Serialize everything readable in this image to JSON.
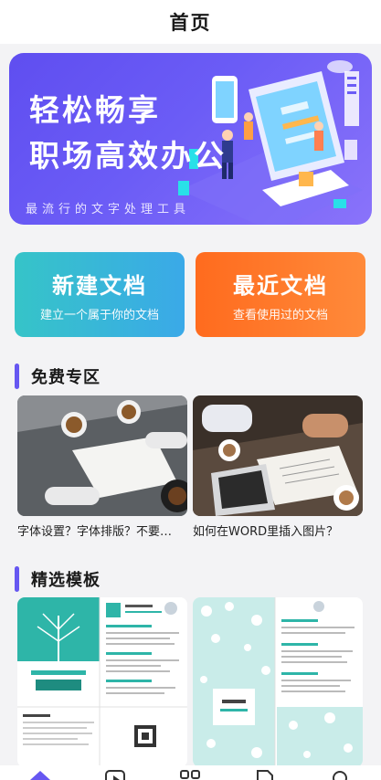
{
  "header": {
    "title": "首页"
  },
  "banner": {
    "line1": "轻松畅享",
    "line2": "职场高效办公",
    "subtitle": "最流行的文字处理工具"
  },
  "actions": {
    "new_doc": {
      "title": "新建文档",
      "subtitle": "建立一个属于你的文档"
    },
    "recent_doc": {
      "title": "最近文档",
      "subtitle": "查看使用过的文档"
    }
  },
  "free_section": {
    "title": "免费专区",
    "articles": [
      {
        "caption": "字体设置？字体排版？不要…"
      },
      {
        "caption": "如何在WORD里插入图片？"
      }
    ]
  },
  "template_section": {
    "title": "精选模板"
  },
  "tabbar": {
    "icons": [
      "home-icon",
      "play-icon",
      "apps-icon",
      "document-icon",
      "profile-icon"
    ]
  },
  "colors": {
    "accent": "#6657f1",
    "new_doc_gradient": [
      "#36c4c8",
      "#3aa9e8"
    ],
    "recent_doc_gradient": [
      "#ff6b1e",
      "#ff8a3a"
    ]
  }
}
